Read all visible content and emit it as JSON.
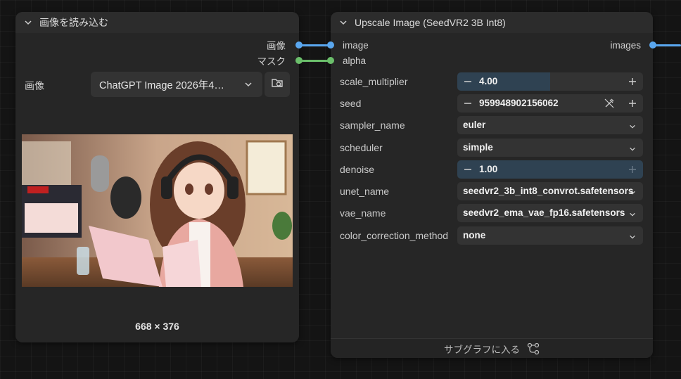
{
  "load_node": {
    "title": "画像を読み込む",
    "outputs": [
      {
        "label": "画像",
        "color": "#5aa7ef"
      },
      {
        "label": "マスク",
        "color": "#6bbf6b"
      }
    ],
    "image_label": "画像",
    "image_value": "ChatGPT Image 2026年4…",
    "dimensions": "668 × 376"
  },
  "upscale_node": {
    "title": "Upscale Image (SeedVR2 3B Int8)",
    "inputs": [
      {
        "label": "image",
        "color": "#5aa7ef"
      },
      {
        "label": "alpha",
        "color": "#6bbf6b"
      }
    ],
    "output": {
      "label": "images",
      "color": "#5aa7ef"
    },
    "params": [
      {
        "label": "scale_multiplier",
        "value": "4.00",
        "kind": "number",
        "fill": 0.5
      },
      {
        "label": "seed",
        "value": "959948902156062",
        "kind": "number",
        "fill": 0
      },
      {
        "label": "sampler_name",
        "value": "euler",
        "kind": "combo"
      },
      {
        "label": "scheduler",
        "value": "simple",
        "kind": "combo"
      },
      {
        "label": "denoise",
        "value": "1.00",
        "kind": "number",
        "fill": 1.0
      },
      {
        "label": "unet_name",
        "value": "seedvr2_3b_int8_convrot.safetensors",
        "kind": "combo"
      },
      {
        "label": "vae_name",
        "value": "seedvr2_ema_vae_fp16.safetensors",
        "kind": "combo"
      },
      {
        "label": "color_correction_method",
        "value": "none",
        "kind": "combo"
      }
    ],
    "footer_label": "サブグラフに入る"
  }
}
